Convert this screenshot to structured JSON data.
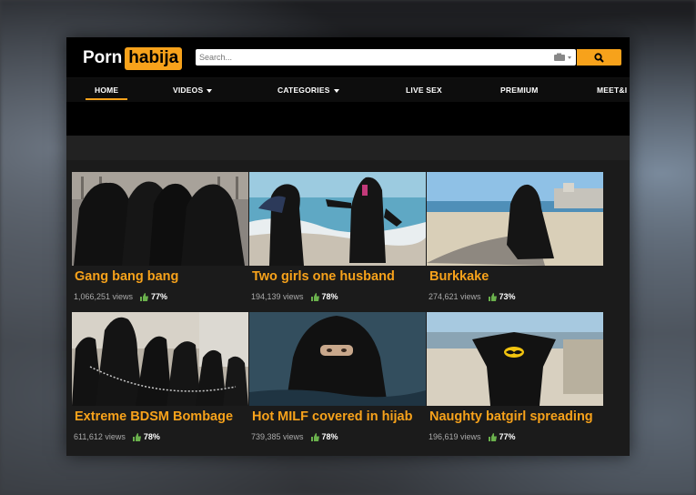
{
  "logo": {
    "left": "Porn",
    "right": "habija"
  },
  "search": {
    "placeholder": "Search..."
  },
  "nav": {
    "items": [
      {
        "label": "HOME",
        "dropdown": false,
        "active": true
      },
      {
        "label": "VIDEOS",
        "dropdown": true,
        "active": false
      },
      {
        "label": "CATEGORIES",
        "dropdown": true,
        "active": false
      },
      {
        "label": "LIVE SEX",
        "dropdown": false,
        "active": false
      },
      {
        "label": "PREMIUM",
        "dropdown": false,
        "active": false
      },
      {
        "label": "MEET&I",
        "dropdown": false,
        "active": false
      }
    ]
  },
  "colors": {
    "accent": "#f7a21b",
    "like": "#6ab04c"
  },
  "videos": [
    {
      "title": "Gang bang bang",
      "views": "1,066,251 views",
      "rating": "77%"
    },
    {
      "title": "Two girls one husband",
      "views": "194,139 views",
      "rating": "78%"
    },
    {
      "title": "Burkkake",
      "views": "274,621 views",
      "rating": "73%"
    },
    {
      "title": "Extreme BDSM Bombage",
      "views": "611,612 views",
      "rating": "78%"
    },
    {
      "title": "Hot MILF covered in hijab",
      "views": "739,385 views",
      "rating": "78%"
    },
    {
      "title": "Naughty batgirl spreading",
      "views": "196,619 views",
      "rating": "77%"
    }
  ]
}
